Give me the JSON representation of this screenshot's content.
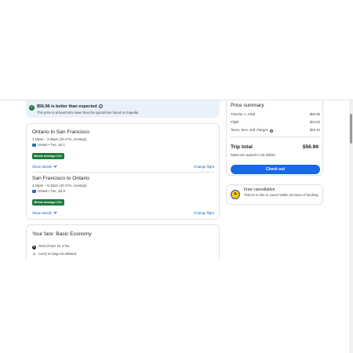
{
  "banner": {
    "title": "$56.96 is better than expected",
    "subtitle": "This price is at least 55% lower than the typical fare found on Expedia",
    "info_glyph": "i",
    "check_glyph": "✓"
  },
  "flights": [
    {
      "route": "Ontario to San Francisco",
      "times": "1:19pm – 2:46pm (1h 27m, nonstop)",
      "airline": "United • Tue, Jul 1",
      "badge": "Below average CO₂",
      "show_details": "Show details",
      "change_flight": "Change flight"
    },
    {
      "route": "San Francisco to Ontario",
      "times": "4:16pm – 5:43pm (1h 27m, nonstop)",
      "airline": "United • Tue, Jul 8",
      "badge": "Below average CO₂",
      "show_details": "Show details",
      "change_flight": "Change flight"
    }
  ],
  "fare": {
    "title": "Your fare: Basic Economy",
    "features": [
      {
        "icon": "dollar-icon",
        "glyph": "$",
        "text": "Seat choice for a fee"
      },
      {
        "icon": "close-icon",
        "glyph": "×",
        "text": "Carry-on bag not allowed"
      }
    ]
  },
  "summary": {
    "title": "Price summary",
    "rows": [
      {
        "label": "Traveler 1: Adult",
        "value": "$56.96"
      },
      {
        "label": "Flight",
        "value": "$24.52"
      },
      {
        "label": "Taxes, fees, and charges",
        "value": "$32.44"
      }
    ],
    "info_glyph": "i",
    "trip_total_label": "Trip total",
    "trip_total_value": "$56.96",
    "rates_note": "Rates are quoted in US dollars",
    "checkout_label": "Check out"
  },
  "cancellation": {
    "title": "Free cancellation",
    "text": "There's no fee to cancel within 24 hours of booking."
  },
  "colors": {
    "accent": "#1668e3",
    "link": "#1565c0",
    "badge_green": "#1e7a3d",
    "banner_bg": "#e9f1fb",
    "clock_yellow": "#f7c800"
  }
}
